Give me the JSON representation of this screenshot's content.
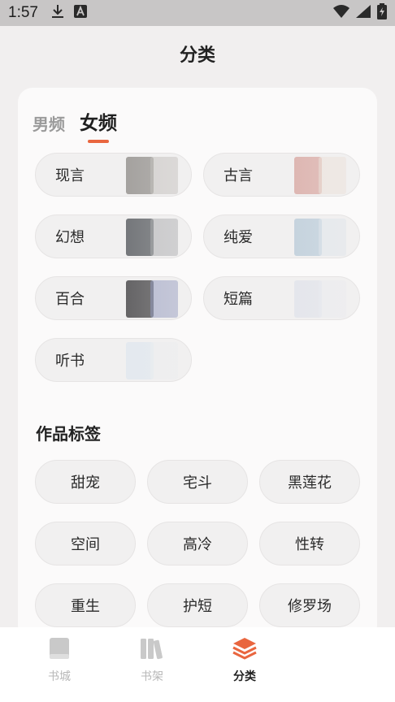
{
  "status_bar": {
    "time": "1:57",
    "icons": [
      "download-icon",
      "a-app-icon",
      "wifi-icon",
      "signal-icon",
      "battery-charging-icon"
    ]
  },
  "page": {
    "title": "分类"
  },
  "gender_tabs": [
    {
      "label": "男频",
      "active": false
    },
    {
      "label": "女频",
      "active": true
    }
  ],
  "categories": [
    {
      "label": "现言",
      "cover_colors": [
        "#8d8a86",
        "#b8b4b0"
      ]
    },
    {
      "label": "古言",
      "cover_colors": [
        "#d8a6a0",
        "#e9dcd4"
      ]
    },
    {
      "label": "幻想",
      "cover_colors": [
        "#4f5257",
        "#9a9ca0"
      ]
    },
    {
      "label": "纯爱",
      "cover_colors": [
        "#b9cad8",
        "#d8e2ea"
      ]
    },
    {
      "label": "百合",
      "cover_colors": [
        "#3b3a3c",
        "#7d86b2"
      ]
    },
    {
      "label": "短篇",
      "cover_colors": [
        "#e1e3ea",
        "#e8e9ee"
      ]
    },
    {
      "label": "听书",
      "cover_colors": [
        "#dfe6ee",
        "#e9ecef"
      ]
    }
  ],
  "tags": {
    "heading": "作品标签",
    "items": [
      "甜宠",
      "宅斗",
      "黑莲花",
      "空间",
      "高冷",
      "性转",
      "重生",
      "护短",
      "修罗场"
    ]
  },
  "bottom_nav": [
    {
      "label": "书城",
      "icon": "book-icon",
      "active": false
    },
    {
      "label": "书架",
      "icon": "bookshelf-icon",
      "active": false
    },
    {
      "label": "分类",
      "icon": "layers-icon",
      "active": true
    }
  ],
  "colors": {
    "accent": "#e9663f",
    "background": "#f1efef",
    "card": "#fbfafa"
  }
}
